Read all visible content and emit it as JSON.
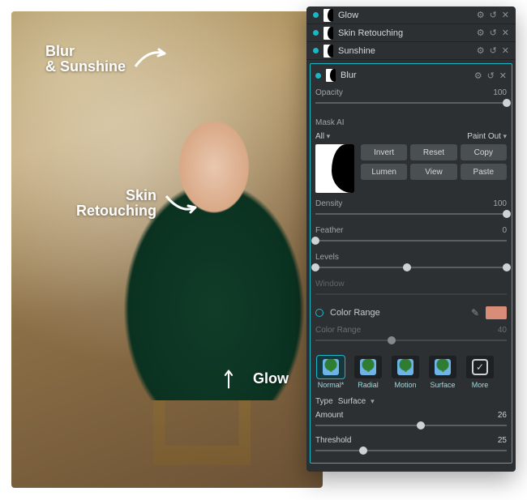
{
  "annotations": {
    "top": "Blur\n& Sunshine",
    "mid": "Skin\nRetouching",
    "low": "Glow"
  },
  "panel": {
    "filters": [
      {
        "name": "Glow"
      },
      {
        "name": "Skin Retouching"
      },
      {
        "name": "Sunshine"
      }
    ],
    "row_icons": {
      "gear": "⚙",
      "undo": "↺",
      "close": "✕"
    },
    "active": {
      "name": "Blur",
      "opacity": {
        "label": "Opacity",
        "value": "100",
        "pos": 1.0
      },
      "mask_ai": {
        "label": "Mask AI",
        "mode_left": "All",
        "mode_right": "Paint Out",
        "buttons": [
          "Invert",
          "Reset",
          "Copy",
          "Lumen",
          "View",
          "Paste"
        ]
      },
      "density": {
        "label": "Density",
        "value": "100",
        "pos": 1.0
      },
      "feather": {
        "label": "Feather",
        "value": "0",
        "pos": 0.0
      },
      "levels": {
        "label": "Levels",
        "low": 0.0,
        "mid": 0.5,
        "high": 1.0
      },
      "window": {
        "label": "Window",
        "disabled": true
      },
      "color_range_toggle": "Color Range",
      "color_range_slider": {
        "label": "Color Range",
        "value": "40",
        "pos": 0.4
      },
      "swatch": "#d88d79",
      "blends": [
        "Normal*",
        "Radial",
        "Motion",
        "Surface",
        "More"
      ],
      "blend_selected": 0,
      "type": {
        "label": "Type",
        "value": "Surface"
      },
      "amount": {
        "label": "Amount",
        "value": "26",
        "pos": 0.55
      },
      "threshold": {
        "label": "Threshold",
        "value": "25",
        "pos": 0.25
      }
    }
  }
}
